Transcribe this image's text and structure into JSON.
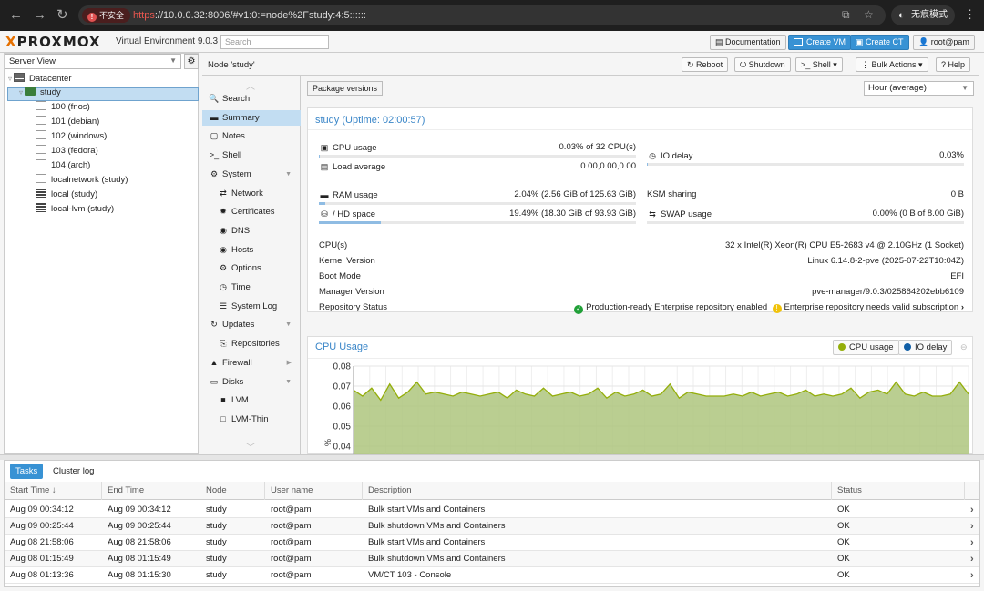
{
  "browser": {
    "security_label": "不安全",
    "url_proto": "https",
    "url_rest": "://10.0.0.32:8006/#v1:0:=node%2Fstudy:4:5::::::",
    "incognito_label": "无痕模式"
  },
  "header": {
    "brand": "PROXMOX",
    "version": "Virtual Environment 9.0.3",
    "search_placeholder": "Search",
    "documentation": "Documentation",
    "create_vm": "Create VM",
    "create_ct": "Create CT",
    "user": "root@pam"
  },
  "tree": {
    "view": "Server View",
    "items": [
      {
        "label": "Datacenter",
        "icon": "datacenter-icon"
      },
      {
        "label": "study",
        "icon": "node-icon"
      },
      {
        "label": "100 (fnos)",
        "icon": "vm-icon"
      },
      {
        "label": "101 (debian)",
        "icon": "vm-icon"
      },
      {
        "label": "102 (windows)",
        "icon": "vm-icon"
      },
      {
        "label": "103 (fedora)",
        "icon": "vm-icon"
      },
      {
        "label": "104 (arch)",
        "icon": "vm-icon"
      },
      {
        "label": "localnetwork (study)",
        "icon": "network-icon"
      },
      {
        "label": "local (study)",
        "icon": "storage-icon"
      },
      {
        "label": "local-lvm (study)",
        "icon": "storage-icon"
      }
    ]
  },
  "toolbar": {
    "crumb": "Node 'study'",
    "reboot": "Reboot",
    "shutdown": "Shutdown",
    "shell": "Shell",
    "bulk": "Bulk Actions",
    "help": "Help"
  },
  "nav": {
    "items": [
      {
        "label": "Search",
        "glyph": "🔍"
      },
      {
        "label": "Summary",
        "glyph": "▬"
      },
      {
        "label": "Notes",
        "glyph": "▢"
      },
      {
        "label": "Shell",
        "glyph": ">_"
      },
      {
        "label": "System",
        "glyph": "⚙"
      },
      {
        "label": "Network",
        "glyph": "⇄"
      },
      {
        "label": "Certificates",
        "glyph": "✹"
      },
      {
        "label": "DNS",
        "glyph": "◉"
      },
      {
        "label": "Hosts",
        "glyph": "◉"
      },
      {
        "label": "Options",
        "glyph": "⚙"
      },
      {
        "label": "Time",
        "glyph": "◷"
      },
      {
        "label": "System Log",
        "glyph": "☰"
      },
      {
        "label": "Updates",
        "glyph": "↻"
      },
      {
        "label": "Repositories",
        "glyph": "⎘"
      },
      {
        "label": "Firewall",
        "glyph": "▲"
      },
      {
        "label": "Disks",
        "glyph": "▭"
      },
      {
        "label": "LVM",
        "glyph": "■"
      },
      {
        "label": "LVM-Thin",
        "glyph": "□"
      }
    ]
  },
  "summary": {
    "package_versions": "Package versions",
    "timeframe": "Hour (average)",
    "title": "study (Uptime: 02:00:57)",
    "cpu_label": "CPU usage",
    "cpu_value": "0.03% of 32 CPU(s)",
    "cpu_fraction": 0.0003,
    "io_label": "IO delay",
    "io_value": "0.03%",
    "io_fraction": 0.0003,
    "load_label": "Load average",
    "load_value": "0.00,0.00,0.00",
    "ram_label": "RAM usage",
    "ram_value": "2.04% (2.56 GiB of 125.63 GiB)",
    "ram_fraction": 0.0204,
    "ksm_label": "KSM sharing",
    "ksm_value": "0 B",
    "hd_label": "/ HD space",
    "hd_value": "19.49% (18.30 GiB of 93.93 GiB)",
    "hd_fraction": 0.1949,
    "swap_label": "SWAP usage",
    "swap_value": "0.00% (0 B of 8.00 GiB)",
    "swap_fraction": 0.0,
    "info": [
      {
        "label": "CPU(s)",
        "value": "32 x Intel(R) Xeon(R) CPU E5-2683 v4 @ 2.10GHz (1 Socket)"
      },
      {
        "label": "Kernel Version",
        "value": "Linux 6.14.8-2-pve (2025-07-22T10:04Z)"
      },
      {
        "label": "Boot Mode",
        "value": "EFI"
      },
      {
        "label": "Manager Version",
        "value": "pve-manager/9.0.3/025864202ebb6109"
      }
    ],
    "repo_label": "Repository Status",
    "repo_ok": "Production-ready Enterprise repository enabled",
    "repo_warn": "Enterprise repository needs valid subscription"
  },
  "cpu_chart": {
    "title": "CPU Usage",
    "legend_cpu": "CPU usage",
    "legend_io": "IO delay",
    "colors": {
      "cpu": "#94ae0a",
      "io": "#115fa6",
      "fill": "#aec57e"
    }
  },
  "chart_data": {
    "type": "area",
    "title": "CPU Usage",
    "ylabel": "%",
    "ylim": [
      0.03,
      0.08
    ],
    "yticks": [
      "0.08",
      "0.07",
      "0.06",
      "0.05",
      "0.04"
    ],
    "series": [
      {
        "name": "CPU usage",
        "values": [
          0.068,
          0.065,
          0.069,
          0.063,
          0.071,
          0.064,
          0.067,
          0.072,
          0.066,
          0.067,
          0.066,
          0.065,
          0.067,
          0.066,
          0.065,
          0.066,
          0.067,
          0.064,
          0.068,
          0.066,
          0.065,
          0.069,
          0.065,
          0.066,
          0.067,
          0.065,
          0.066,
          0.069,
          0.064,
          0.067,
          0.065,
          0.066,
          0.068,
          0.065,
          0.066,
          0.071,
          0.064,
          0.067,
          0.066,
          0.065,
          0.065,
          0.065,
          0.066,
          0.065,
          0.067,
          0.065,
          0.066,
          0.067,
          0.065,
          0.066,
          0.068,
          0.065,
          0.066,
          0.065,
          0.066,
          0.069,
          0.064,
          0.067,
          0.068,
          0.066,
          0.072,
          0.066,
          0.065,
          0.067,
          0.065,
          0.065,
          0.066,
          0.072,
          0.066
        ]
      },
      {
        "name": "IO delay",
        "values": []
      }
    ]
  },
  "tasks": {
    "tab_tasks": "Tasks",
    "tab_cluster": "Cluster log",
    "columns": [
      "Start Time ↓",
      "End Time",
      "Node",
      "User name",
      "Description",
      "Status"
    ],
    "rows": [
      [
        "Aug 09 00:34:12",
        "Aug 09 00:34:12",
        "study",
        "root@pam",
        "Bulk start VMs and Containers",
        "OK"
      ],
      [
        "Aug 09 00:25:44",
        "Aug 09 00:25:44",
        "study",
        "root@pam",
        "Bulk shutdown VMs and Containers",
        "OK"
      ],
      [
        "Aug 08 21:58:06",
        "Aug 08 21:58:06",
        "study",
        "root@pam",
        "Bulk start VMs and Containers",
        "OK"
      ],
      [
        "Aug 08 01:15:49",
        "Aug 08 01:15:49",
        "study",
        "root@pam",
        "Bulk shutdown VMs and Containers",
        "OK"
      ],
      [
        "Aug 08 01:13:36",
        "Aug 08 01:15:30",
        "study",
        "root@pam",
        "VM/CT 103 - Console",
        "OK"
      ]
    ]
  }
}
